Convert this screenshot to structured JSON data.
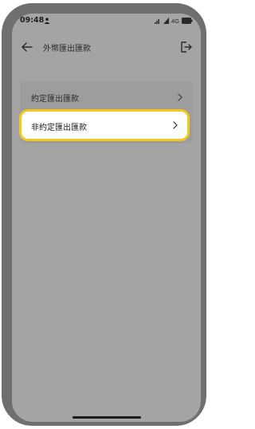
{
  "status_bar": {
    "time": "09:48",
    "network": "4G",
    "icons": [
      "person-icon",
      "wifi-icon",
      "signal-icon",
      "battery-icon"
    ]
  },
  "app_bar": {
    "title": "外幣匯出匯款",
    "back_icon": "arrow-left-icon",
    "exit_icon": "logout-icon"
  },
  "menu": {
    "items": [
      {
        "label": "約定匯出匯款",
        "icon": "chevron-right-icon"
      },
      {
        "label": "非約定匯出匯款",
        "icon": "chevron-right-icon",
        "highlighted": true
      }
    ]
  },
  "colors": {
    "highlight_border": "#f2c81d",
    "screen_overlay": "#a3a4a3",
    "frame": "#6f6f6f"
  }
}
